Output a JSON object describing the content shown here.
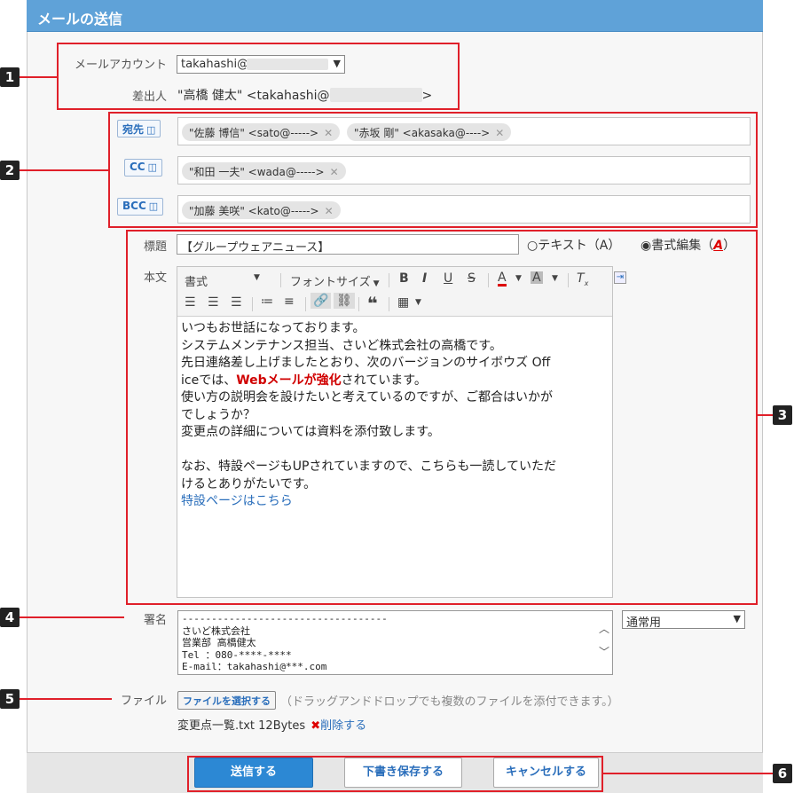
{
  "window": {
    "title": "メールの送信"
  },
  "account": {
    "label": "メールアカウント",
    "value": "takahashi@"
  },
  "sender": {
    "label": "差出人",
    "value_prefix": "\"高橋 健太\" <takahashi@",
    "value_suffix": ">"
  },
  "recipients": {
    "to": {
      "button": "宛先",
      "chips": [
        "\"佐藤 博信\" <sato@----->",
        "\"赤坂 剛\" <akasaka@---->"
      ]
    },
    "cc": {
      "button": "CC",
      "chips": [
        "\"和田 一夫\" <wada@----->"
      ]
    },
    "bcc": {
      "button": "BCC",
      "chips": [
        "\"加藤 美咲\" <kato@----->"
      ]
    }
  },
  "subject": {
    "label": "標題",
    "value": "【グループウェアニュース】",
    "mode_text": "テキスト（A）",
    "mode_rich": "書式編集（",
    "mode_rich_icon": "A",
    "mode_rich_close": "）"
  },
  "body": {
    "label": "本文",
    "toolbar": {
      "format": "書式",
      "font_size": "フォントサイズ"
    },
    "lines": [
      "いつもお世話になっております。",
      "システムメンテナンス担当、さいど株式会社の高橋です。",
      "先日連絡差し上げましたとおり、次のバージョンのサイボウズ Off",
      "",
      "使い方の説明会を設けたいと考えているのですが、ご都合はいかが",
      "でしょうか？",
      "変更点の詳細については資料を添付致します。",
      "",
      "なお、特設ページもUPされていますので、こちらも一読していただ",
      "けるとありがたいです。"
    ],
    "line4_pre": "iceでは、",
    "line4_highlight": "Webメールが強化",
    "line4_post": "されています。",
    "link": "特設ページはこちら"
  },
  "signature": {
    "label": "署名",
    "lines": [
      "-----------------------------------",
      "さいど株式会社",
      "営業部 高橋健太",
      "Tel   ：080-****-****",
      "E-mail：takahashi@***.com"
    ],
    "select_value": "通常用"
  },
  "file": {
    "label": "ファイル",
    "button": "ファイルを選択する",
    "hint": "（ドラッグアンドドロップでも複数のファイルを添付できます。）",
    "attached_name": "変更点一覧.txt 12Bytes",
    "delete_label": "削除する"
  },
  "footer": {
    "send": "送信する",
    "draft": "下書き保存する",
    "cancel": "キャンセルする"
  },
  "callouts": [
    "1",
    "2",
    "3",
    "4",
    "5",
    "6"
  ],
  "colors": {
    "accent": "#5fa2d8",
    "annotation": "#e0202a",
    "primary_button": "#2c88d4"
  }
}
